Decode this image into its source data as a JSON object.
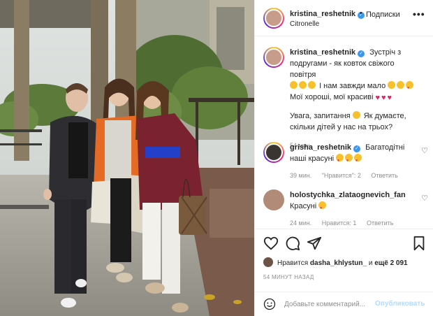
{
  "header": {
    "username": "kristina_reshetnik",
    "separator": "•",
    "follow_label": "Подписки",
    "location": "Citronelle",
    "more_label": "•••"
  },
  "caption": {
    "username": "kristina_reshetnik",
    "text_line1": "Зустріч з подругами - як ковток свіжого повітря",
    "text_line2": "І нам завжди мало",
    "text_line3": "Мої хороші, мої красиві",
    "text_line4": "Увага, запитання",
    "text_line5": "Як думаєте, скільки дітей у нас на трьох?",
    "time": "54 мин."
  },
  "comments": [
    {
      "username": "grisha_reshetnik",
      "text": "Багатодітні наші красуні",
      "time": "39 мин.",
      "likes": "\"Нравится\": 2",
      "reply": "Ответить"
    },
    {
      "username": "holostychka_zlataognevich_fan",
      "text": "Красуні",
      "time": "24 мин.",
      "likes": "Нравится: 1",
      "reply": "Ответить"
    }
  ],
  "likes": {
    "prefix": "Нравится",
    "user": "dasha_khlystun_",
    "middle": "и",
    "rest": "ещё 2 091"
  },
  "post_time": "54 МИНУТ НАЗАД",
  "add_comment": {
    "placeholder": "Добавьте комментарий...",
    "post_label": "Опубликовать"
  },
  "colors": {
    "verified": "#3897f0",
    "heart": "#e0245e",
    "link_disabled": "#b3dbff",
    "secondary_text": "#8e8e8e"
  }
}
